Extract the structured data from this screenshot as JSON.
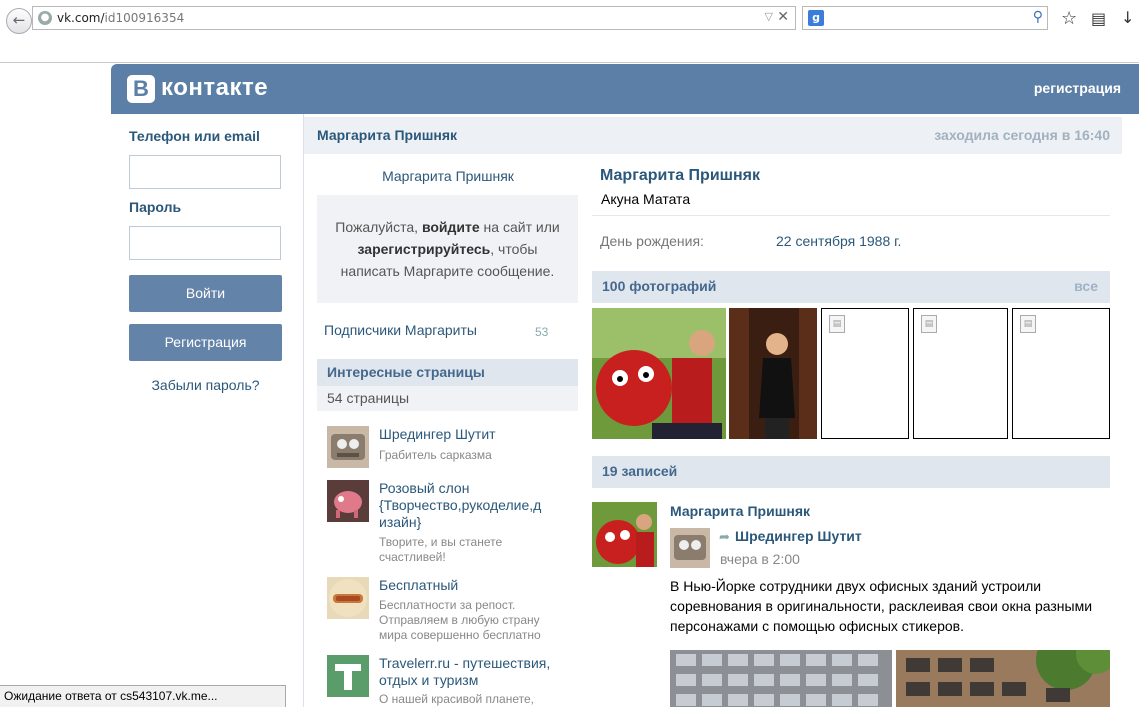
{
  "browser": {
    "url_prefix": "vk.com/",
    "url_path": "id100916354",
    "search_engine_icon": "g",
    "status": "Ожидание ответа от cs543107.vk.me..."
  },
  "header": {
    "logo_letter": "В",
    "logo_text": "контакте",
    "register_link": "регистрация"
  },
  "login": {
    "phone_label": "Телефон или email",
    "phone_value": "",
    "password_label": "Пароль",
    "password_value": "",
    "login_button": "Войти",
    "register_button": "Регистрация",
    "forgot_link": "Забыли пароль?"
  },
  "profile_bar": {
    "name": "Маргарита Пришняк",
    "last_seen": "заходила сегодня в 16:40"
  },
  "left_col": {
    "name": "Маргарита Пришняк",
    "msg_pre": "Пожалуйста, ",
    "msg_login": "войдите",
    "msg_mid": " на сайт или ",
    "msg_register": "зарегистрируйтесь",
    "msg_post": ", чтобы написать Маргарите сообщение.",
    "subscribers_label": "Подписчики Маргариты",
    "subscribers_count": "53",
    "interesting_title": "Интересные страницы",
    "interesting_count": "54 страницы",
    "groups": [
      {
        "name": "Шредингер Шутит",
        "desc": "Грабитель сарказма"
      },
      {
        "name": "Розовый слон {Творчество,рукоделие,д изайн}",
        "desc": "Творите, и вы станете счастливей!"
      },
      {
        "name": "Бесплатный",
        "desc": "Бесплатности за репост. Отправляем в любую страну мира совершенно бесплатно"
      },
      {
        "name": "Travelerr.ru - путешествия, отдых и туризм",
        "desc": "О нашей красивой планете,"
      }
    ]
  },
  "info": {
    "name": "Маргарита Пришняк",
    "status": "Акуна Матата",
    "birthday_label": "День рождения:",
    "birthday_value": "22 сентября 1988 г."
  },
  "photos": {
    "title": "100 фотографий",
    "all_link": "все"
  },
  "wall": {
    "title": "19 записей",
    "post": {
      "author": "Маргарита Пришняк",
      "repost_from": "Шредингер Шутит",
      "time": "вчера в 2:00",
      "text": "В Нью-Йорке сотрудники двух офисных зданий устроили соревнования в оригинальности, расклеивая свои окна разными персонажами с помощью офисных стикеров."
    }
  },
  "colors": {
    "header_bg": "#5b7fa6",
    "link": "#2b587a",
    "button_bg": "#6383a8",
    "section_bg": "#dfe6ee"
  }
}
